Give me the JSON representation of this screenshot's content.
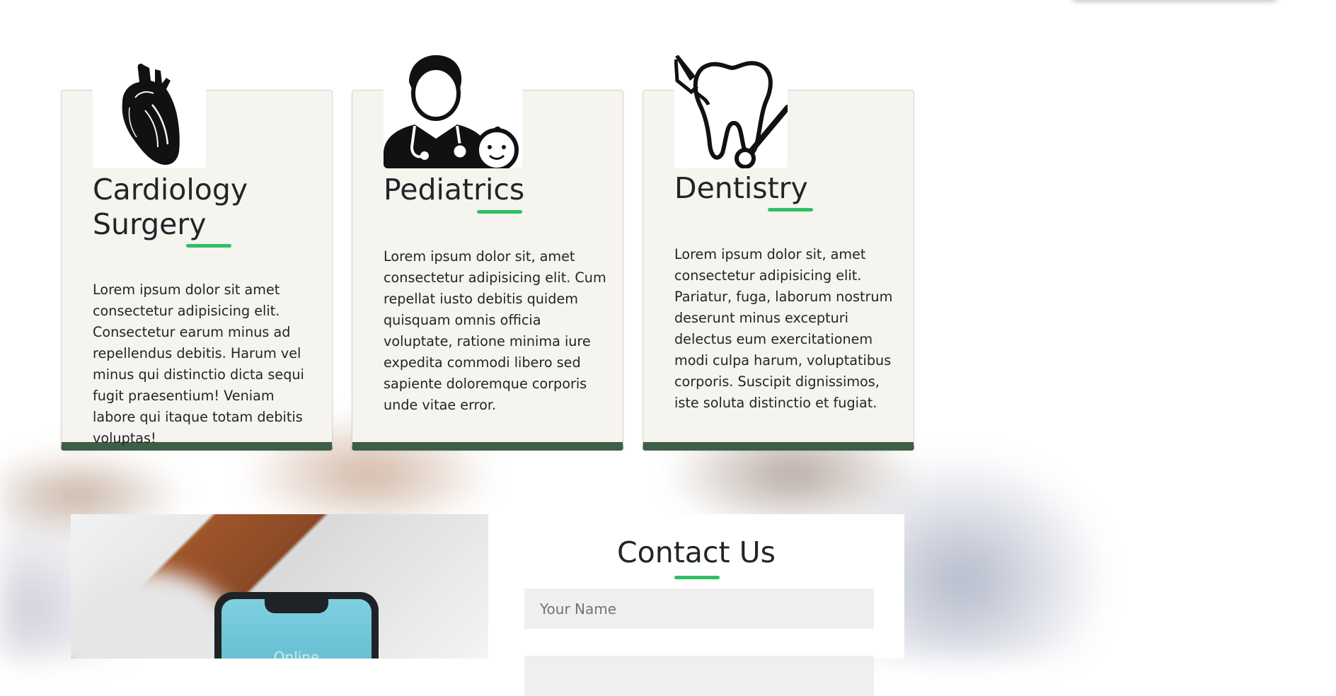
{
  "services": [
    {
      "icon": "heart-icon",
      "title": "Cardiology Surgery",
      "title_line1": "Cardiology",
      "title_line2": "Surgery",
      "description": "Lorem ipsum dolor sit amet consectetur adipisicing elit. Consectetur earum minus ad repellendus debitis. Harum vel minus qui distinctio dicta sequi fugit praesentium! Veniam labore qui itaque totam debitis voluptas!"
    },
    {
      "icon": "pediatrician-icon",
      "title": "Pediatrics",
      "description": "Lorem ipsum dolor sit, amet consectetur adipisicing elit. Cum repellat iusto debitis quidem quisquam omnis officia voluptate, ratione minima iure expedita commodi libero sed sapiente doloremque corporis unde vitae error."
    },
    {
      "icon": "tooth-dental-tools-icon",
      "title": "Dentistry",
      "description": "Lorem ipsum dolor sit, amet consectetur adipisicing elit. Pariatur, fuga, laborum nostrum deserunt minus excepturi delectus eum exercitationem modi culpa harum, voluptatibus corporis. Suscipit dignissimos, iste soluta distinctio et fugiat."
    }
  ],
  "contact": {
    "title": "Contact Us",
    "name_placeholder": "Your Name",
    "name_value": "",
    "phone_screen_text": "Online"
  },
  "colors": {
    "accent": "#2fbf63",
    "card_bottom_border": "#3e5e48",
    "card_background": "#f5f4ef",
    "input_background": "#efefef"
  }
}
